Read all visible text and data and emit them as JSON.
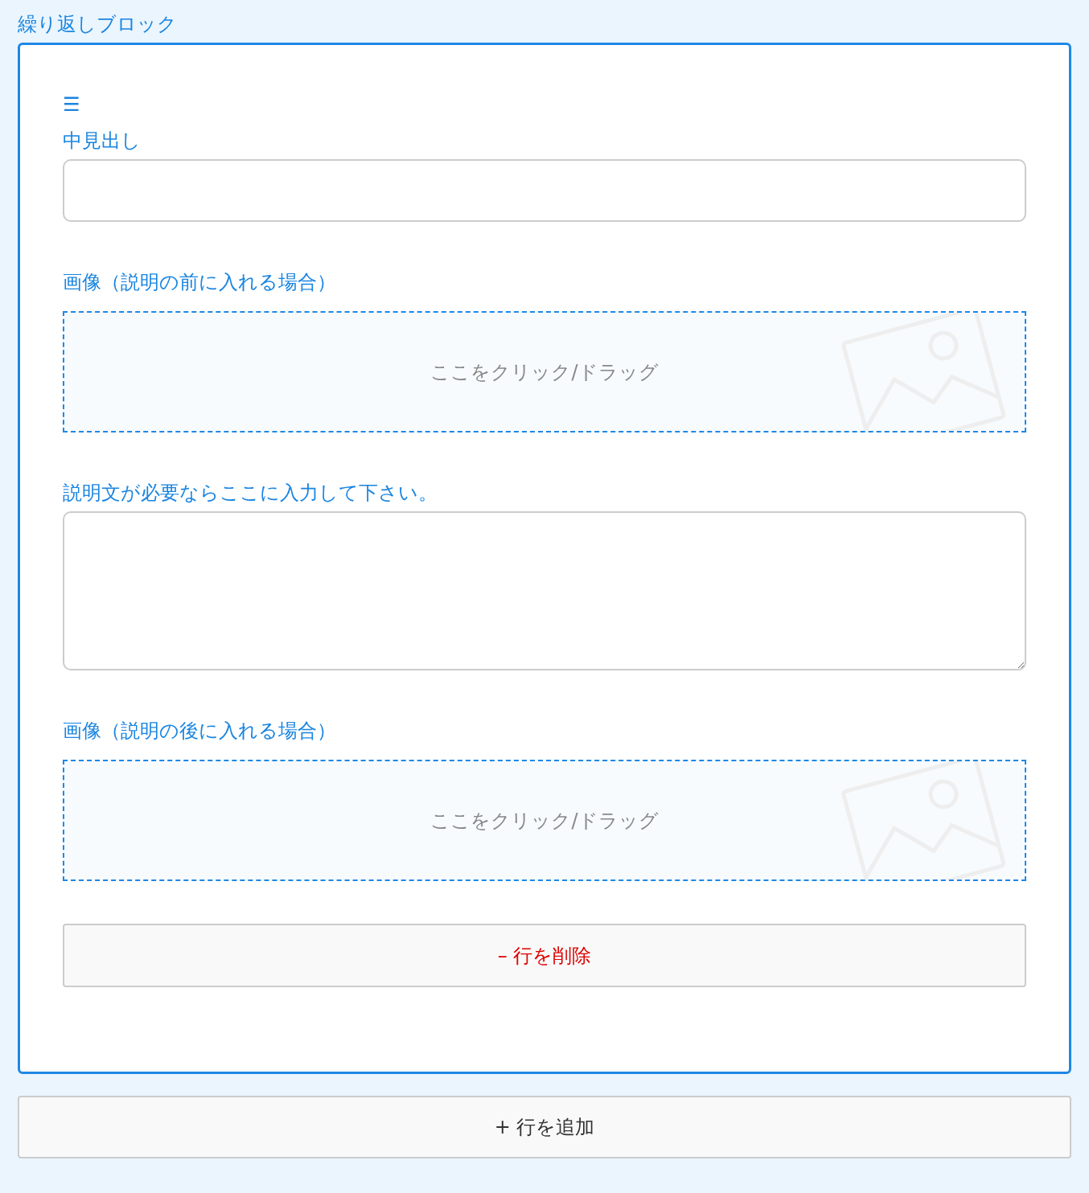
{
  "title": "繰り返しブロック",
  "rows": [
    {
      "handle": "☰",
      "fields": [
        {
          "kind": "input",
          "label": "中見出し"
        },
        {
          "kind": "image",
          "label": "画像（説明の前に入れる場合）",
          "prompt": "ここをクリック/ドラッグ"
        },
        {
          "kind": "textarea",
          "label": "説明文が必要ならここに入力して下さい。"
        },
        {
          "kind": "image",
          "label": "画像（説明の後に入れる場合）",
          "prompt": "ここをクリック/ドラッグ"
        }
      ],
      "remove_button": "– 行を削除"
    }
  ],
  "add_button": "+ 行を追加"
}
